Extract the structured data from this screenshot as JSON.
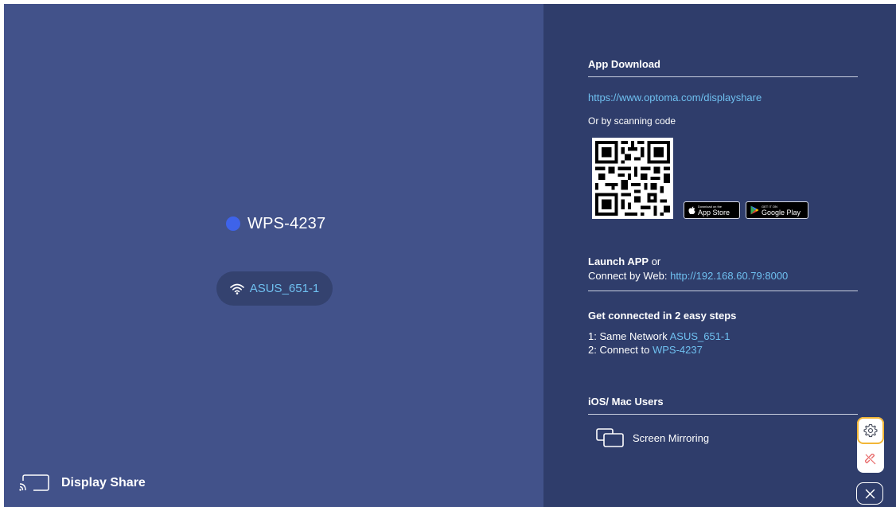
{
  "device": {
    "name": "WPS-4237"
  },
  "network": {
    "name": "ASUS_651-1",
    "icon": "wifi-icon"
  },
  "footer": {
    "label": "Display Share",
    "icon": "cast-icon"
  },
  "app_download": {
    "title": "App Download",
    "url": "https://www.optoma.com/displayshare",
    "scan_text": "Or by scanning code",
    "app_store": {
      "small": "Download on the",
      "big": "App Store"
    },
    "google_play": {
      "small": "GET IT ON",
      "big": "Google Play"
    }
  },
  "launch": {
    "line1_bold": "Launch APP",
    "line1_rest": " or",
    "line2_prefix": "Connect by Web: ",
    "line2_link": "http://192.168.60.79:8000"
  },
  "steps": {
    "title": "Get connected in 2 easy steps",
    "step1_prefix": "1: Same Network ",
    "step1_value": "ASUS_651-1",
    "step2_prefix": "2: Connect to ",
    "step2_value": "WPS-4237"
  },
  "ios": {
    "title": "iOS/ Mac Users",
    "mirroring_label": "Screen Mirroring",
    "mirroring_icon": "screen-mirroring-icon"
  },
  "colors": {
    "left_bg": "#42528a",
    "right_bg": "#2f3d6b",
    "accent_link": "#6fc0f0",
    "device_dot": "#3e63ea",
    "gear_border": "#f2b636",
    "unlink": "#e86a6a"
  }
}
